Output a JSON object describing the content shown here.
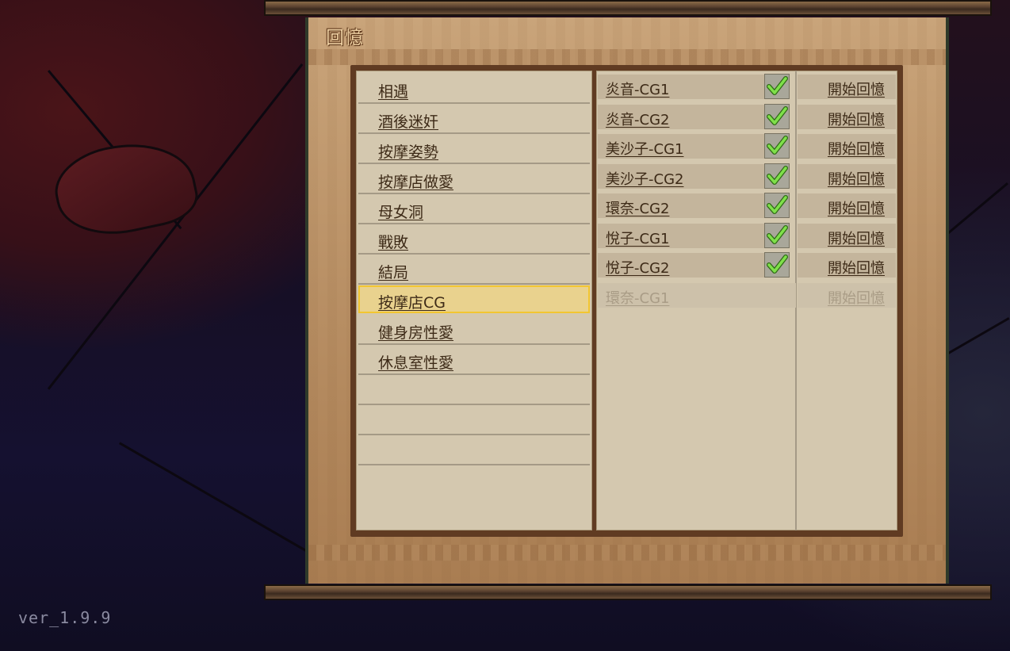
{
  "screen": {
    "title": "回憶",
    "version": "ver_1.9.9"
  },
  "categories": [
    {
      "label": "相遇",
      "selected": false
    },
    {
      "label": "酒後迷奸",
      "selected": false
    },
    {
      "label": "按摩姿勢",
      "selected": false
    },
    {
      "label": "按摩店做愛",
      "selected": false
    },
    {
      "label": "母女洞",
      "selected": false
    },
    {
      "label": "戰敗",
      "selected": false
    },
    {
      "label": "結局",
      "selected": false
    },
    {
      "label": "按摩店CG",
      "selected": true
    },
    {
      "label": "健身房性愛",
      "selected": false
    },
    {
      "label": "休息室性愛",
      "selected": false
    },
    {
      "label": "",
      "selected": false
    },
    {
      "label": "",
      "selected": false
    },
    {
      "label": "",
      "selected": false
    }
  ],
  "entries": [
    {
      "name": "炎音-CG1",
      "unlocked": true,
      "action": "開始回憶"
    },
    {
      "name": "炎音-CG2",
      "unlocked": true,
      "action": "開始回憶"
    },
    {
      "name": "美沙子-CG1",
      "unlocked": true,
      "action": "開始回憶"
    },
    {
      "name": "美沙子-CG2",
      "unlocked": true,
      "action": "開始回憶"
    },
    {
      "name": "環奈-CG2",
      "unlocked": true,
      "action": "開始回憶"
    },
    {
      "name": "悅子-CG1",
      "unlocked": true,
      "action": "開始回憶"
    },
    {
      "name": "悅子-CG2",
      "unlocked": true,
      "action": "開始回憶"
    },
    {
      "name": "環奈-CG1",
      "unlocked": false,
      "action": "開始回憶"
    }
  ],
  "colors": {
    "selected_highlight": "#e9d28e",
    "selected_border": "#f2c631",
    "check_green": "#7fe04a",
    "text_brown": "#3d2a17",
    "locked_text": "#a99c86"
  },
  "icons": {
    "unlocked_marker": "checkmark-icon"
  }
}
